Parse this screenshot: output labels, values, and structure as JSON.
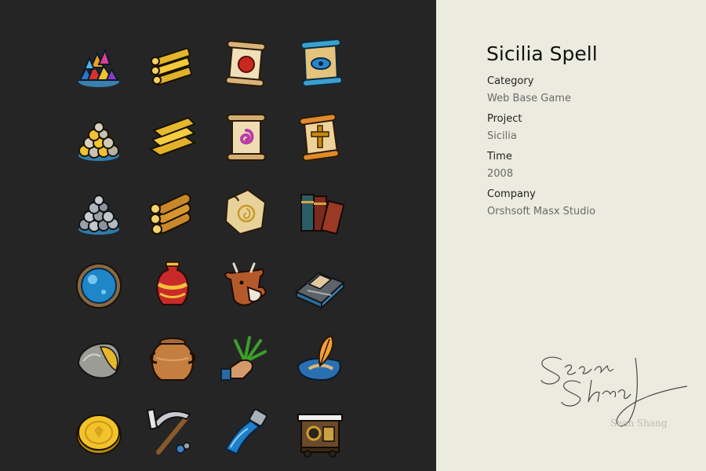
{
  "project": {
    "title": "Sicilia Spell",
    "fields": [
      {
        "label": "Category",
        "value": "Web Base Game"
      },
      {
        "label": "Project",
        "value": "Sicilia"
      },
      {
        "label": "Time",
        "value": "2008"
      },
      {
        "label": "Company",
        "value": "Orshsoft Masx Studio"
      }
    ]
  },
  "signature": {
    "caption": "Sean Shang"
  },
  "icons": [
    "gems-pile-icon",
    "gold-lumber-icon",
    "scroll-red-emblem-icon",
    "scroll-blue-eye-icon",
    "gold-nuggets-pile-icon",
    "gold-planks-icon",
    "scroll-purple-swirl-icon",
    "scroll-cross-icon",
    "stone-pile-icon",
    "log-pile-icon",
    "treasure-map-icon",
    "books-icon",
    "crystal-orb-icon",
    "painted-vase-icon",
    "cow-icon",
    "slate-tiles-icon",
    "ore-rock-icon",
    "clay-pot-icon",
    "hand-with-herbs-icon",
    "quill-on-cloth-icon",
    "gold-coin-icon",
    "pickaxe-icon",
    "water-pipe-icon",
    "furnace-machine-icon"
  ],
  "colors": {
    "left_background": "#252525",
    "right_background": "#ebebe0"
  }
}
